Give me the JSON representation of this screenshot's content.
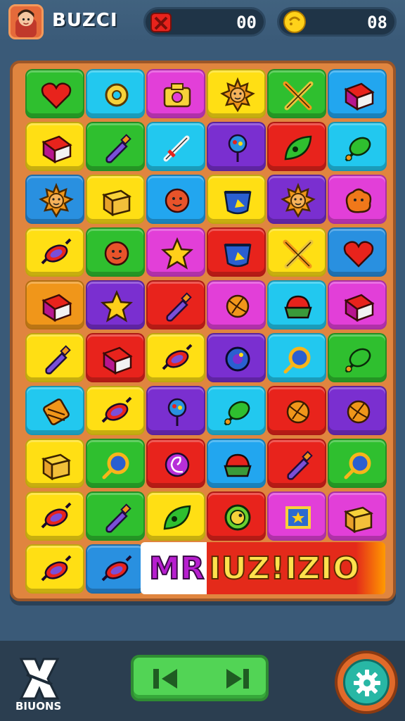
{
  "header": {
    "title": "BUZCI",
    "lives_value": "00",
    "coins_value": "08",
    "lives_icon": "red-x-icon",
    "coins_icon": "yellow-coin-icon"
  },
  "board": {
    "banner": {
      "part1": "MR",
      "part2": "IUZ!IZIO"
    },
    "tiles": [
      {
        "color": "#2fbf2f",
        "icon": "heart-icon"
      },
      {
        "color": "#22c8ef",
        "icon": "yellow-ring-icon"
      },
      {
        "color": "#e23fd8",
        "icon": "camera-icon"
      },
      {
        "color": "#ffdf14",
        "icon": "sun-face-icon"
      },
      {
        "color": "#2fbf2f",
        "icon": "crossed-swords-icon"
      },
      {
        "color": "#22a6ef",
        "icon": "book-icon"
      },
      {
        "color": "#ffdf14",
        "icon": "book-icon"
      },
      {
        "color": "#2fbf2f",
        "icon": "bottle-icon"
      },
      {
        "color": "#22c8ef",
        "icon": "sword-icon"
      },
      {
        "color": "#7a2fd0",
        "icon": "flower-icon"
      },
      {
        "color": "#e8231c",
        "icon": "leaf-icon"
      },
      {
        "color": "#22c8ef",
        "icon": "berry-icon"
      },
      {
        "color": "#2990e0",
        "icon": "sun-face-icon"
      },
      {
        "color": "#ffdf14",
        "icon": "box-icon"
      },
      {
        "color": "#22a6ef",
        "icon": "face-icon"
      },
      {
        "color": "#ffdf14",
        "icon": "pot-icon"
      },
      {
        "color": "#7a2fd0",
        "icon": "sun-face-icon"
      },
      {
        "color": "#e23fd8",
        "icon": "blob-icon"
      },
      {
        "color": "#ffdf14",
        "icon": "candy-icon"
      },
      {
        "color": "#2fbf2f",
        "icon": "face-icon"
      },
      {
        "color": "#e23fd8",
        "icon": "star-icon"
      },
      {
        "color": "#e8231c",
        "icon": "pot-icon"
      },
      {
        "color": "#ffdf14",
        "icon": "crossed-swords-icon"
      },
      {
        "color": "#2990e0",
        "icon": "heart-icon"
      },
      {
        "color": "#f0961a",
        "icon": "book-icon"
      },
      {
        "color": "#7a2fd0",
        "icon": "star-icon"
      },
      {
        "color": "#e8231c",
        "icon": "bottle-icon"
      },
      {
        "color": "#e23fd8",
        "icon": "ball-icon"
      },
      {
        "color": "#22c8ef",
        "icon": "cake-icon"
      },
      {
        "color": "#e23fd8",
        "icon": "book-icon"
      },
      {
        "color": "#ffdf14",
        "icon": "bottle-icon"
      },
      {
        "color": "#e8231c",
        "icon": "book-icon"
      },
      {
        "color": "#ffdf14",
        "icon": "candy-icon"
      },
      {
        "color": "#7a2fd0",
        "icon": "orb-icon"
      },
      {
        "color": "#22c8ef",
        "icon": "ring-icon"
      },
      {
        "color": "#2fbf2f",
        "icon": "berry-icon"
      },
      {
        "color": "#22c8ef",
        "icon": "scroll-icon"
      },
      {
        "color": "#ffdf14",
        "icon": "candy-icon"
      },
      {
        "color": "#7a2fd0",
        "icon": "flower-icon"
      },
      {
        "color": "#22c8ef",
        "icon": "berry-icon"
      },
      {
        "color": "#e8231c",
        "icon": "ball-icon"
      },
      {
        "color": "#7a2fd0",
        "icon": "ball-icon"
      },
      {
        "color": "#ffdf14",
        "icon": "box-icon"
      },
      {
        "color": "#2fbf2f",
        "icon": "ring-icon"
      },
      {
        "color": "#e8231c",
        "icon": "swirl-icon"
      },
      {
        "color": "#22a6ef",
        "icon": "cake-icon"
      },
      {
        "color": "#e8231c",
        "icon": "bottle-icon"
      },
      {
        "color": "#2fbf2f",
        "icon": "ring-icon"
      },
      {
        "color": "#ffdf14",
        "icon": "candy-icon"
      },
      {
        "color": "#2fbf2f",
        "icon": "bottle-icon"
      },
      {
        "color": "#ffdf14",
        "icon": "leaf-icon"
      },
      {
        "color": "#e8231c",
        "icon": "smile-icon"
      },
      {
        "color": "#e23fd8",
        "icon": "star-box-icon"
      },
      {
        "color": "#e23fd8",
        "icon": "box-icon"
      },
      {
        "color": "#ffdf14",
        "icon": "candy-icon"
      },
      {
        "color": "#2990e0",
        "icon": "candy-icon"
      }
    ]
  },
  "footer": {
    "logo_label": "BIUONS",
    "logo_icon": "crossed-x-icon",
    "prev_icon": "previous-icon",
    "next_icon": "next-icon",
    "settings_icon": "gear-icon"
  }
}
